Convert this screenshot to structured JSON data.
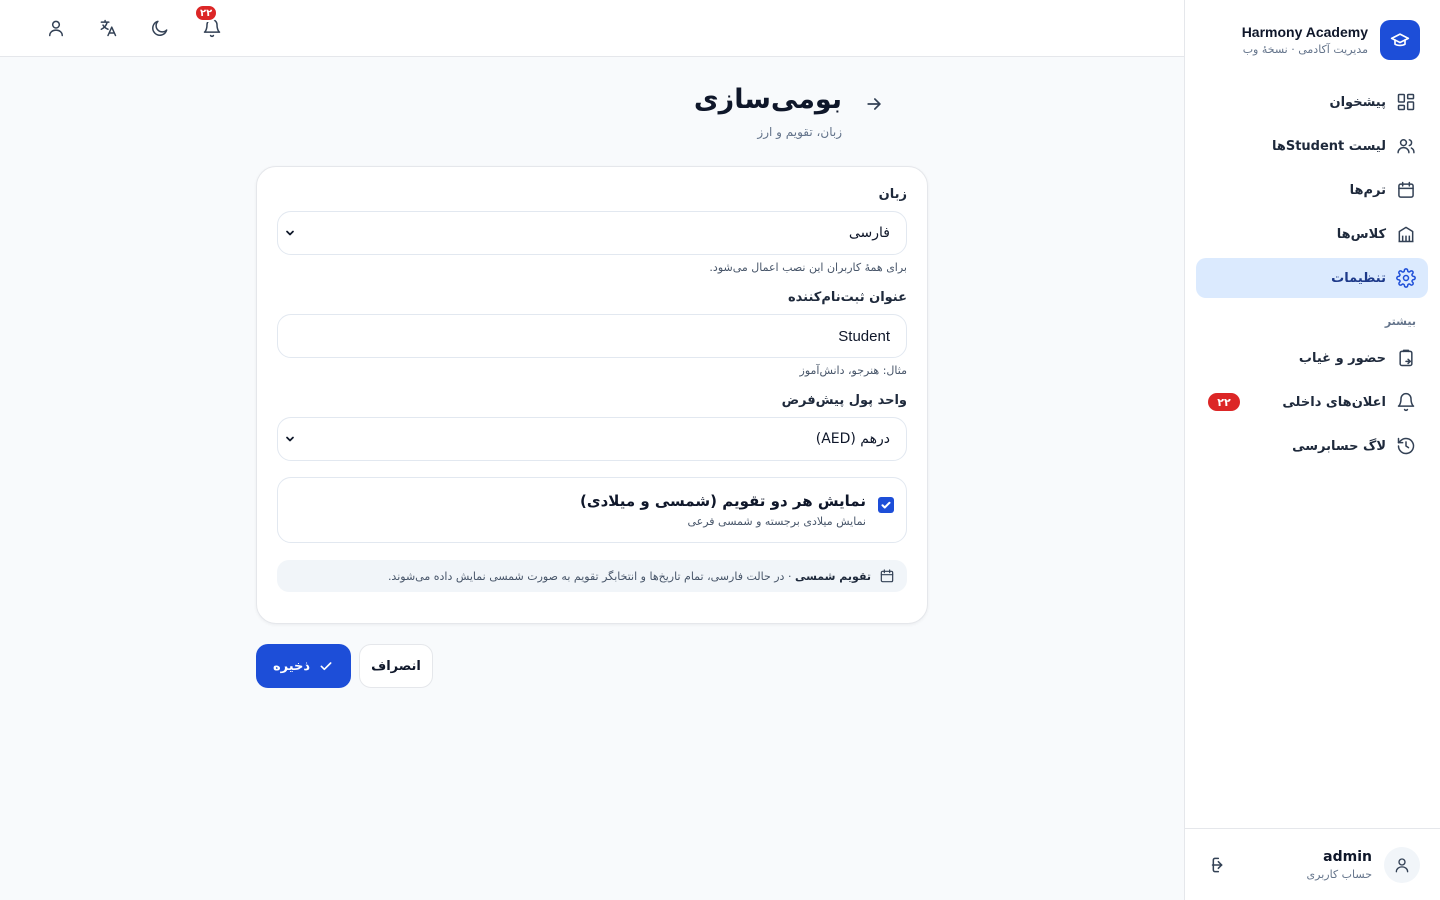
{
  "brand": {
    "name": "Harmony Academy",
    "subtitle": "مدیریت آکادمی · نسخهٔ وب",
    "logo_icon": "graduation-cap-icon"
  },
  "sidebar": {
    "items": [
      {
        "label": "پیشخوان",
        "icon": "dashboard-icon"
      },
      {
        "label": "لیست Studentها",
        "icon": "users-icon"
      },
      {
        "label": "ترم‌ها",
        "icon": "calendar-icon"
      },
      {
        "label": "کلاس‌ها",
        "icon": "building-icon"
      },
      {
        "label": "تنظیمات",
        "icon": "gear-icon",
        "active": true
      }
    ],
    "section_more": "بیشتر",
    "more_items": [
      {
        "label": "حضور و غیاب",
        "icon": "clipboard-icon"
      },
      {
        "label": "اعلان‌های داخلی",
        "icon": "bell-icon",
        "badge": "۲۲"
      },
      {
        "label": "لاگ حسابرسی",
        "icon": "history-icon"
      }
    ]
  },
  "user": {
    "name": "admin",
    "role": "حساب کاربری"
  },
  "topbar": {
    "notifications_count": "۲۲"
  },
  "page": {
    "title": "بومی‌سازی",
    "subtitle": "زبان، تقویم و ارز"
  },
  "form": {
    "language": {
      "label": "زبان",
      "value": "فارسی",
      "help": "برای همهٔ کاربران این نصب اعمال می‌شود."
    },
    "enrollee_title": {
      "label": "عنوان ثبت‌نام‌کننده",
      "value": "Student",
      "help": "مثال: هنرجو، دانش‌آموز"
    },
    "currency": {
      "label": "واحد پول پیش‌فرض",
      "value": "درهم (AED)"
    },
    "dual_calendar": {
      "title": "نمایش هر دو تقویم (شمسی و میلادی)",
      "subtitle": "نمایش میلادی برجسته و شمسی فرعی",
      "checked": true
    },
    "info": {
      "bold": "تقویم شمسی",
      "text": " · در حالت فارسی، تمام تاریخ‌ها و انتخابگر تقویم به صورت شمسی نمایش داده می‌شوند."
    }
  },
  "actions": {
    "save": "ذخیره",
    "cancel": "انصراف"
  },
  "colors": {
    "accent": "#1d4ed8",
    "active_bg": "#dbeafe",
    "badge": "#dc2626"
  }
}
